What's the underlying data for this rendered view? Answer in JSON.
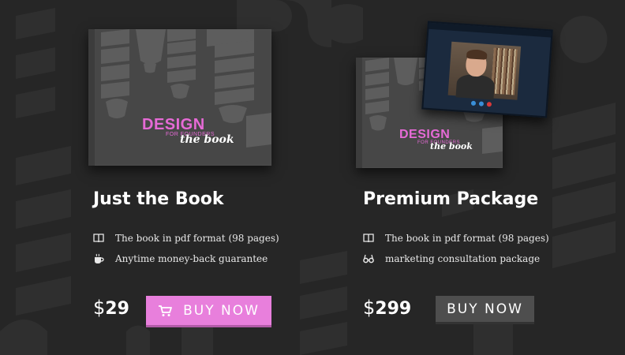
{
  "colors": {
    "background": "#262626",
    "accent": "#e87fdc",
    "accent_text": "#e66ad6",
    "dark_button": "#4e4e4e"
  },
  "book_cover": {
    "title": "DESIGN",
    "subtitle": "FOR FOUNDERS",
    "script": "the book"
  },
  "products": [
    {
      "heading": "Just the Book",
      "features": [
        {
          "icon": "book-icon",
          "text": "The book in pdf format (98 pages)"
        },
        {
          "icon": "coffee-cup-icon",
          "text": "Anytime money-back guarantee"
        }
      ],
      "price": {
        "currency": "$",
        "amount": "29"
      },
      "button": {
        "label": "BUY NOW",
        "icon": "cart-icon"
      }
    },
    {
      "heading": "Premium Package",
      "features": [
        {
          "icon": "book-icon",
          "text": "The book in pdf format (98 pages)"
        },
        {
          "icon": "glasses-icon",
          "text": "marketing consultation package"
        }
      ],
      "price": {
        "currency": "$",
        "amount": "299"
      },
      "button": {
        "label": "BUY NOW"
      }
    }
  ]
}
